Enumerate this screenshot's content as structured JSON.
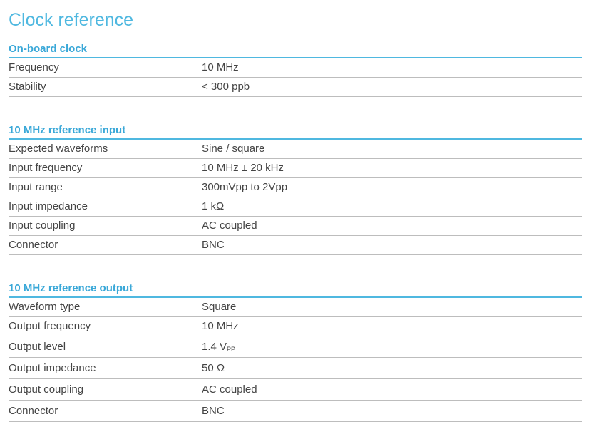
{
  "title": "Clock reference",
  "sections": [
    {
      "header": "On-board clock",
      "rows": [
        {
          "label": "Frequency",
          "value": "10 MHz"
        },
        {
          "label": "Stability",
          "value": "< 300 ppb"
        }
      ]
    },
    {
      "header": "10 MHz reference input",
      "rows": [
        {
          "label": "Expected waveforms",
          "value": "Sine / square"
        },
        {
          "label": "Input frequency",
          "value": "10 MHz ± 20 kHz"
        },
        {
          "label": "Input range",
          "value": "300mVpp to 2Vpp"
        },
        {
          "label": "Input impedance",
          "value": "1 kΩ"
        },
        {
          "label": "Input coupling",
          "value": "AC coupled"
        },
        {
          "label": "Connector",
          "value": "BNC"
        }
      ]
    },
    {
      "header": "10 MHz reference output",
      "rows": [
        {
          "label": "Waveform type",
          "value": "Square"
        },
        {
          "label": "Output frequency",
          "value": "10 MHz"
        },
        {
          "label": "Output level",
          "value": "1.4 V",
          "value_sub": "PP"
        },
        {
          "label": "Output impedance",
          "value": "50 Ω"
        },
        {
          "label": "Output coupling",
          "value": "AC coupled"
        },
        {
          "label": "Connector",
          "value": "BNC"
        }
      ]
    }
  ]
}
